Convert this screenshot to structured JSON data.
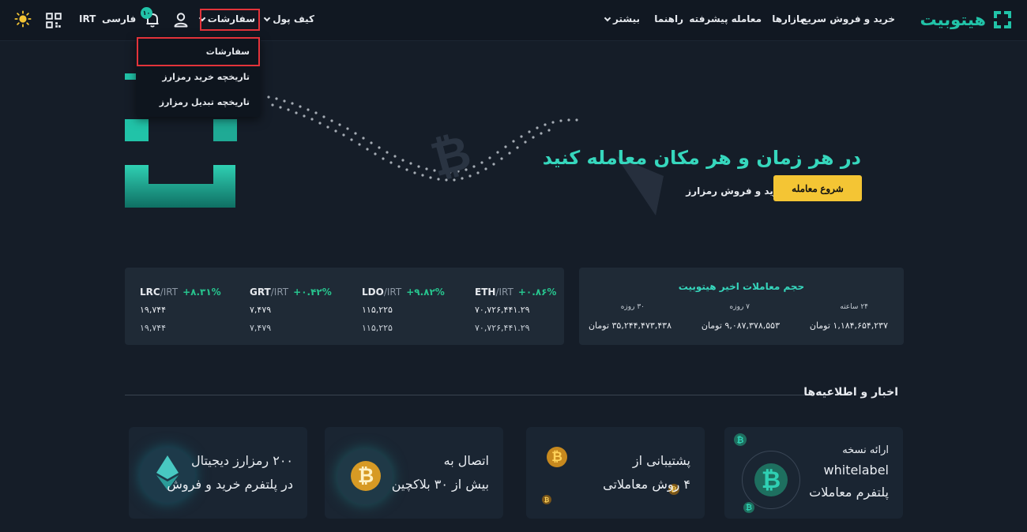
{
  "header": {
    "logo_text": "هیتوبیت",
    "nav": {
      "quick_trade": "خرید و فروش سریع",
      "markets": "بازارها",
      "advanced_trade": "معامله پیشرفته",
      "guide": "راهنما",
      "more": "بیشتر"
    },
    "wallet": "کیف پول",
    "orders": "سفارشات",
    "notification_count": "۱۰",
    "language": "فارسی",
    "currency": "IRT",
    "icons": {
      "logo": "hitobit-logo-icon",
      "user": "user-icon",
      "bell": "bell-icon",
      "qr": "qr-code-icon",
      "theme": "sun-icon"
    }
  },
  "orders_menu": {
    "items": [
      {
        "label": "سفارشات"
      },
      {
        "label": "تاریخچه خرید رمزارز"
      },
      {
        "label": "تاریخچه تبدیل رمزارز"
      }
    ]
  },
  "hero": {
    "title": "در هر زمان و هر مکان معامله کنید",
    "subtitle": "پلتفرم هوشمند خرید و فروش رمزارز",
    "cta": "شروع معامله"
  },
  "ticker": [
    {
      "base": "ETH",
      "quote": "/IRT",
      "change": "+۰.۸۶%",
      "price": "۷۰,۷۲۶,۴۴۱.۲۹",
      "price2": "۷۰,۷۲۶,۴۴۱.۲۹"
    },
    {
      "base": "LDO",
      "quote": "/IRT",
      "change": "+۹.۸۲%",
      "price": "۱۱۵,۲۲۵",
      "price2": "۱۱۵,۲۲۵"
    },
    {
      "base": "GRT",
      "quote": "/IRT",
      "change": "+۰.۴۲%",
      "price": "۷,۴۷۹",
      "price2": "۷,۴۷۹"
    },
    {
      "base": "LRC",
      "quote": "/IRT",
      "change": "+۸.۳۱%",
      "price": "۱۹,۷۴۴",
      "price2": "۱۹,۷۴۴"
    }
  ],
  "stats": {
    "title": "حجم معاملات اخیر هیتوبیت",
    "items": [
      {
        "period": "۲۴ ساعته",
        "value": "۱,۱۸۴,۶۵۴,۲۳۷ تومان"
      },
      {
        "period": "۷ روزه",
        "value": "۹,۰۸۷,۳۷۸,۵۵۳ تومان"
      },
      {
        "period": "۳۰ روزه",
        "value": "۳۵,۲۴۴,۴۷۳,۴۳۸ تومان"
      }
    ]
  },
  "news": {
    "title": "اخبار و اطلاعیه‌ها",
    "cards": [
      {
        "line1": "ارائه نسخه",
        "line2": "whitelabel",
        "line3": "پلتفرم معاملات"
      },
      {
        "line1": "پشتیبانی از",
        "line2": "۴ روش معاملاتی"
      },
      {
        "line1": "اتصال به",
        "line2": "بیش از ۳۰ بلاکچین"
      },
      {
        "line1": "۲۰۰ رمزارز دیجیتال",
        "line2": "در پلتفرم خرید و فروش"
      }
    ]
  },
  "colors": {
    "accent": "#36d7bd",
    "brand": "#21c3a8",
    "cta": "#f4c534",
    "positive": "#27c48e",
    "highlight_box": "#e3333a",
    "background": "#151d28"
  }
}
